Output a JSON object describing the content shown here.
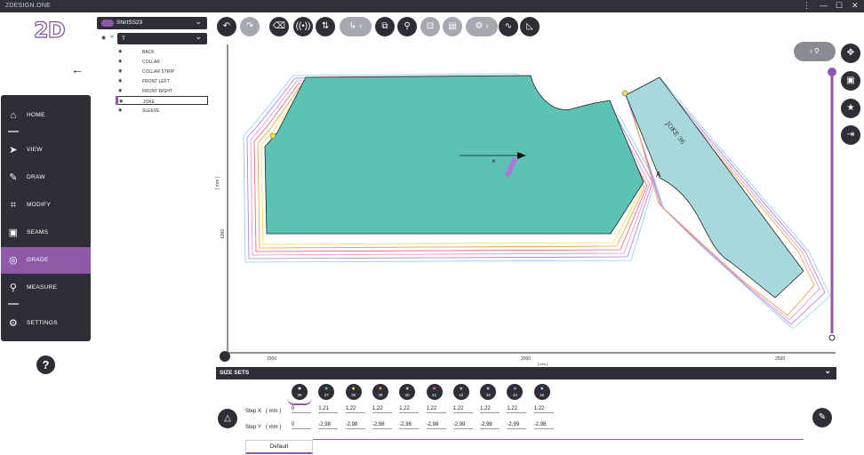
{
  "window": {
    "title": "2DESIGN.ONE",
    "controls": [
      "⋮",
      "—",
      "☐",
      "✕"
    ]
  },
  "app": {
    "logo": "2D"
  },
  "sidebar": {
    "items": [
      {
        "label": "HOME",
        "icon": "home-icon",
        "glyph": "⌂"
      },
      {
        "label": "VIEW",
        "icon": "cursor-icon",
        "glyph": "➤"
      },
      {
        "label": "DRAW",
        "icon": "pencil-icon",
        "glyph": "✎"
      },
      {
        "label": "MODIFY",
        "icon": "modify-nodes-icon",
        "glyph": "⌗"
      },
      {
        "label": "SEAMS",
        "icon": "seams-icon",
        "glyph": "▣"
      },
      {
        "label": "GRADE",
        "icon": "grade-target-icon",
        "glyph": "◎",
        "active": true
      },
      {
        "label": "MEASURE",
        "icon": "measure-icon",
        "glyph": "⚲"
      },
      {
        "label": "SETTINGS",
        "icon": "settings-icon",
        "glyph": "⚙"
      }
    ],
    "help": "?"
  },
  "tree": {
    "project": "ShirtSS23",
    "model": "T",
    "pieces": [
      "BACK",
      "COLLAR",
      "COLLAR STRIP",
      "FRONT LEFT",
      "FRONT RIGHT",
      "JOKE",
      "SLEEVE"
    ],
    "selected": "JOKE"
  },
  "canvas": {
    "x_ticks": [
      "1500",
      "2000",
      "2500"
    ],
    "y_ticks": [
      "1000"
    ],
    "unit": "[ mm ]",
    "piece_labels": {
      "joke": "JOKE 36",
      "point": "A"
    },
    "accent": "#8e5aa8",
    "piece_fill": "#5cc2b4",
    "piece_fill2": "#a7d9dc"
  },
  "size_sets": {
    "title": "SIZE SETS",
    "sizes": [
      {
        "label": "36",
        "color": "#ffffff"
      },
      {
        "label": "37",
        "color": "#55c97a"
      },
      {
        "label": "38",
        "color": "#f2e04b"
      },
      {
        "label": "39",
        "color": "#f29a3c"
      },
      {
        "label": "40",
        "color": "#f4a2b8"
      },
      {
        "label": "41",
        "color": "#ef5a74"
      },
      {
        "label": "42",
        "color": "#e98ad6"
      },
      {
        "label": "43",
        "color": "#9fb7ff"
      },
      {
        "label": "44",
        "color": "#a47bd6"
      },
      {
        "label": "45",
        "color": "#8ec9ff"
      }
    ],
    "step_x": {
      "label": "Step X",
      "unit": "( mm )",
      "values": [
        "0",
        "1,21",
        "1,22",
        "1,22",
        "1,22",
        "1,22",
        "1,22",
        "1,22",
        "1,22",
        "1,22"
      ]
    },
    "step_y": {
      "label": "Step Y",
      "unit": "( mm )",
      "values": [
        "0",
        "-2,98",
        "-2,98",
        "-2,98",
        "-2,98",
        "-2,98",
        "-2,99",
        "-2,98",
        "-2,99",
        "-2,98"
      ]
    },
    "tab": "Default"
  }
}
